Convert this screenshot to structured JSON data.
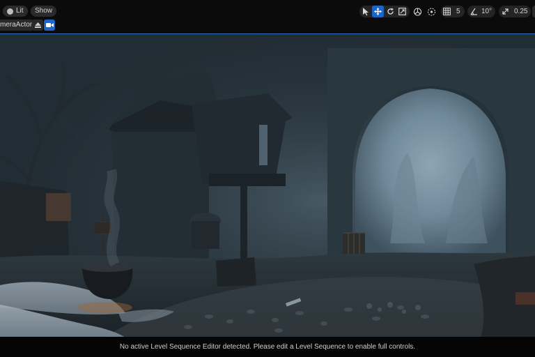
{
  "toolbar": {
    "view_mode_label": "Lit",
    "show_label": "Show",
    "camera_label": "meraActor",
    "grid_snap_value": "5",
    "rotation_snap_value": "10°",
    "scale_snap_value": "0.25",
    "accent_color": "#1f64c8"
  },
  "status": {
    "message": "No active Level Sequence Editor detected. Please edit a Level Sequence to enable full controls."
  }
}
